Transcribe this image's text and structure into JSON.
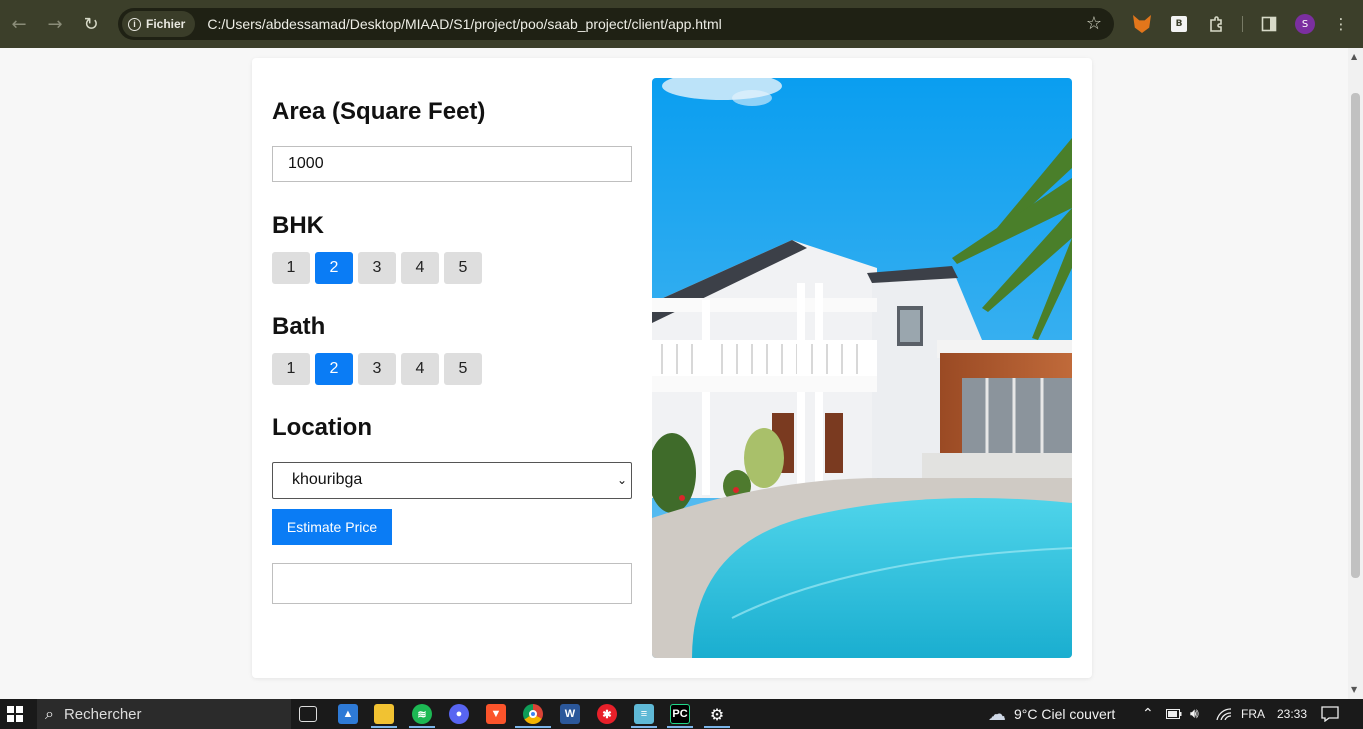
{
  "browser": {
    "site_chip": "Fichier",
    "url": "C:/Users/abdessamad/Desktop/MIAAD/S1/project/poo/saab_project/client/app.html",
    "profile_initial": "S",
    "ext_b_label": "B"
  },
  "form": {
    "area_label": "Area (Square Feet)",
    "area_value": "1000",
    "bhk_label": "BHK",
    "bhk_options": [
      "1",
      "2",
      "3",
      "4",
      "5"
    ],
    "bhk_selected": "2",
    "bath_label": "Bath",
    "bath_options": [
      "1",
      "2",
      "3",
      "4",
      "5"
    ],
    "bath_selected": "2",
    "location_label": "Location",
    "location_value": "khouribga",
    "estimate_button": "Estimate Price",
    "result_text": ""
  },
  "taskbar": {
    "search_text": "Rechercher",
    "weather": "9°C  Ciel couvert",
    "language": "FRA",
    "time": "23:33"
  },
  "colors": {
    "accent": "#0a7cf5",
    "chrome_bg": "#3c3f2a",
    "taskbar_bg": "#1a1a1a"
  },
  "icons": [
    "back-icon",
    "forward-icon",
    "reload-icon",
    "info-icon",
    "star-icon",
    "metamask-icon",
    "extensions-icon",
    "sidepanel-icon",
    "menu-icon",
    "windows-start-icon",
    "search-icon",
    "task-view-icon",
    "photos-icon",
    "file-explorer-icon",
    "spotify-icon",
    "discord-icon",
    "brave-icon",
    "chrome-icon",
    "word-icon",
    "app-red-icon",
    "notepad-icon",
    "pycharm-icon",
    "settings-icon",
    "weather-icon",
    "chevron-up-icon",
    "battery-icon",
    "volume-icon",
    "wifi-icon",
    "notification-icon"
  ]
}
